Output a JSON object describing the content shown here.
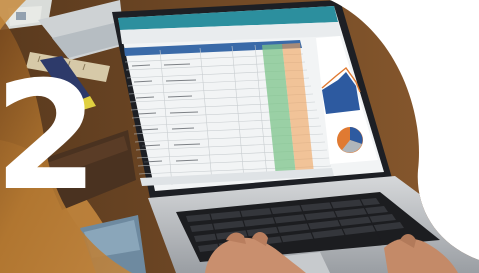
{
  "badge": {
    "number": "2"
  },
  "colors": {
    "background": "#ffffff",
    "wood": "#b0752f",
    "header_teal": "#2c8f9e",
    "laptop_silver": "#b8bcc0",
    "keyboard": "#1c1d20",
    "sheet_green": "#3e9a50",
    "sheet_orange": "#e07a32"
  },
  "icons": {
    "spreadsheet": "spreadsheet-icon",
    "laptop": "laptop-icon",
    "hands": "hands-icon"
  }
}
